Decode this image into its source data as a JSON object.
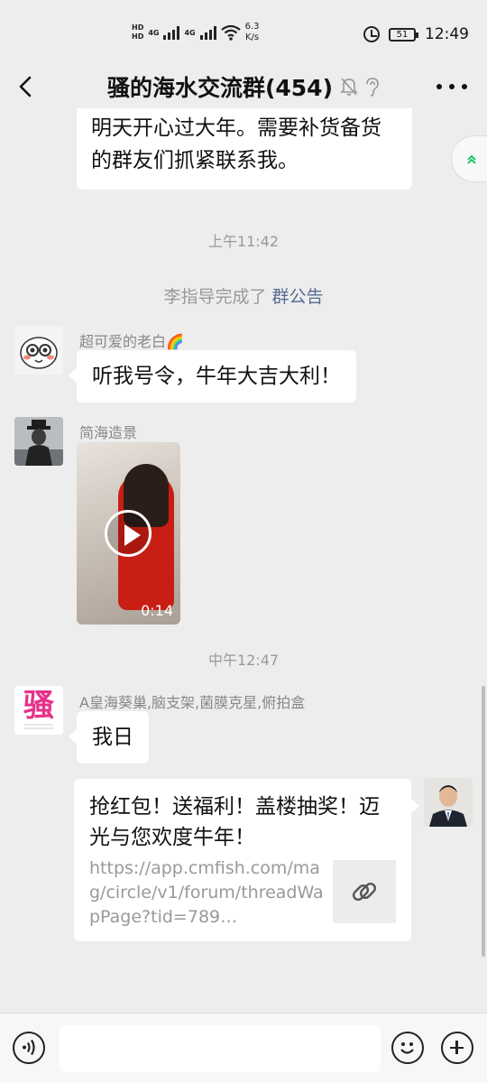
{
  "status_bar": {
    "hd1": "HD",
    "hd2": "HD",
    "net1": "4G",
    "net2": "4G",
    "speed_value": "6.3",
    "speed_unit": "K/s",
    "battery": "51",
    "time": "12:49"
  },
  "header": {
    "title": "骚的海水交流群(454)"
  },
  "messages": {
    "announcement_tail": "明天开心过大年。需要补货备货的群友们抓紧联系我。",
    "time1": "上午11:42",
    "system_actor": "李指导完成了",
    "system_link": "群公告",
    "msg1_sender": "超可爱的老白🌈",
    "msg1_text": "听我号令，牛年大吉大利！",
    "msg2_sender": "简海造景",
    "msg2_video_duration": "0:14",
    "time2": "中午12:47",
    "msg3_sender": "A皇海葵巢,脑支架,菌膜克星,俯拍盒",
    "msg3_avatar_char": "骚",
    "msg3_text": "我日",
    "msg4_link_title": "抢红包！送福利！盖楼抽奖！迈光与您欢度牛年！",
    "msg4_link_url": "https://app.cmfish.com/mag/circle/v1/forum/threadWapPage?tid=789…"
  },
  "icons": {
    "back": "chevron-left-icon",
    "mute": "bell-off-icon",
    "ear": "ear-icon",
    "more": "more-icon",
    "link": "link-icon",
    "voice": "voice-icon",
    "emoji": "emoji-icon",
    "plus": "plus-icon"
  },
  "colors": {
    "background": "#ededed",
    "bubble": "#ffffff",
    "link_blue": "#576b95",
    "muted_text": "#999999"
  }
}
